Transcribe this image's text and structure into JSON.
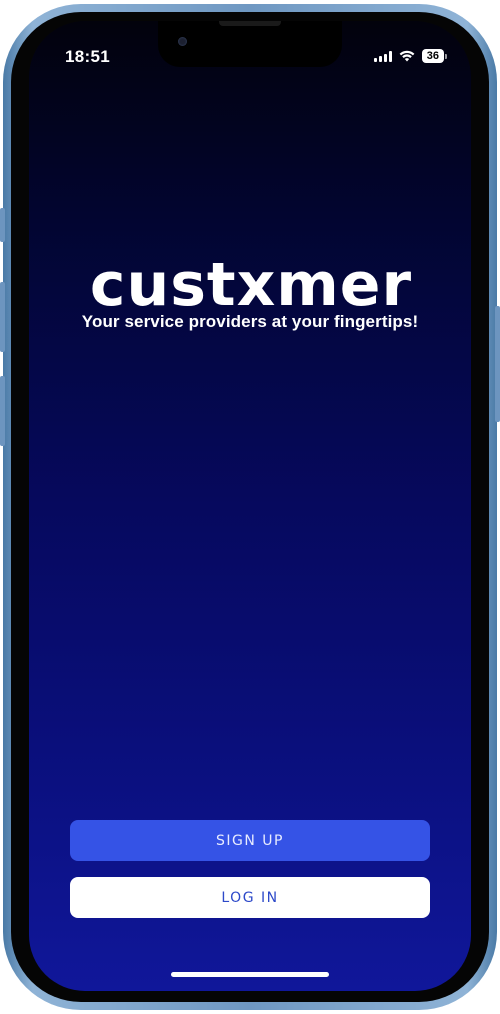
{
  "status_bar": {
    "time": "18:51",
    "battery": "36"
  },
  "brand": {
    "logo_text": "custxmer",
    "tagline": "Your service providers at your fingertips!"
  },
  "actions": {
    "signup_label": "SIGN UP",
    "login_label": "LOG IN"
  },
  "colors": {
    "signup_bg": "#3553e6",
    "login_bg": "#ffffff",
    "gradient_top": "#02020c",
    "gradient_bottom": "#10179a"
  },
  "icons": {
    "signal": "cellular-signal-icon",
    "wifi": "wifi-icon",
    "battery": "battery-icon"
  }
}
